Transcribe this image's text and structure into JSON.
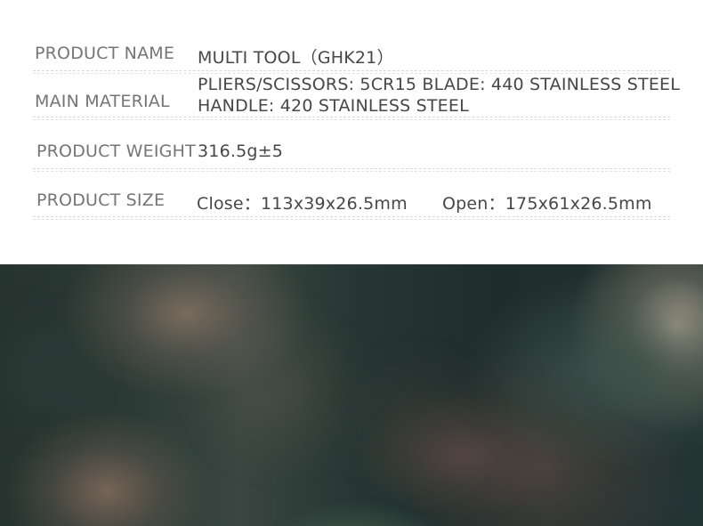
{
  "spec_table": {
    "rows": [
      {
        "label": "PRODUCT NAME",
        "value": "MULTI TOOL（GHK21）"
      },
      {
        "label": "MAIN MATERIAL",
        "value_lines": [
          "PLIERS/SCISSORS: 5CR15 BLADE: 440 STAINLESS STEEL",
          "HANDLE: 420 STAINLESS STEEL"
        ]
      },
      {
        "label": "PRODUCT WEIGHT",
        "value": "316.5g±5"
      },
      {
        "label": "PRODUCT SIZE",
        "close_value": "Close：113x39x26.5mm",
        "open_value": "Open：175x61x26.5mm"
      }
    ]
  },
  "colors": {
    "label_text": "#757575",
    "value_text": "#474747",
    "divider": "#d8d8d8"
  }
}
